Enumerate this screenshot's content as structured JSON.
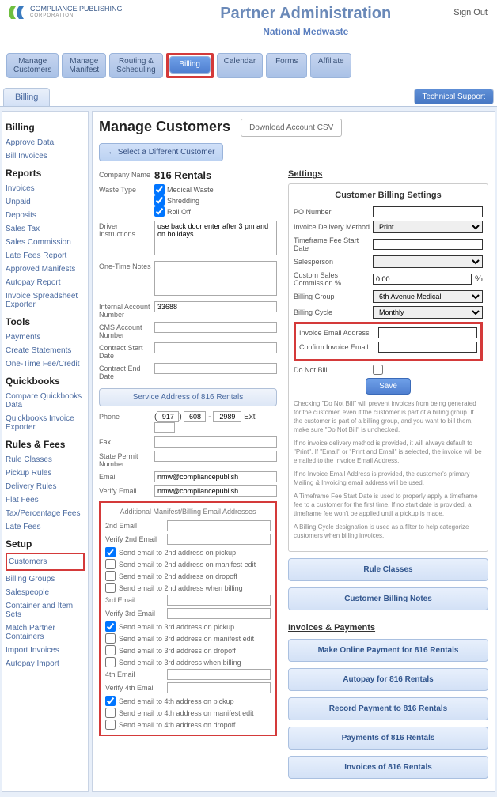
{
  "header": {
    "brand_top": "COMPLIANCE PUBLISHING",
    "brand_sub": "CORPORATION",
    "title": "Partner Administration",
    "subtitle": "National Medwaste",
    "signout": "Sign Out"
  },
  "nav": {
    "items": [
      {
        "line1": "Manage",
        "line2": "Customers"
      },
      {
        "line1": "Manage",
        "line2": "Manifest"
      },
      {
        "line1": "Routing &",
        "line2": "Scheduling"
      },
      {
        "line1": "Billing",
        "line2": ""
      },
      {
        "line1": "Calendar",
        "line2": ""
      },
      {
        "line1": "Forms",
        "line2": ""
      },
      {
        "line1": "Affiliate",
        "line2": ""
      }
    ],
    "active_index": 3
  },
  "tabs": {
    "main": "Billing",
    "support": "Technical Support"
  },
  "sidebar": {
    "sections": [
      {
        "heading": "Billing",
        "links": [
          "Approve Data",
          "Bill Invoices"
        ]
      },
      {
        "heading": "Reports",
        "links": [
          "Invoices",
          "Unpaid",
          "Deposits",
          "Sales Tax",
          "Sales Commission",
          "Late Fees Report",
          "Approved Manifests",
          "Autopay Report",
          "Invoice Spreadsheet Exporter"
        ]
      },
      {
        "heading": "Tools",
        "links": [
          "Payments",
          "Create Statements",
          "One-Time Fee/Credit"
        ]
      },
      {
        "heading": "Quickbooks",
        "links": [
          "Compare Quickbooks Data",
          "Quickbooks Invoice Exporter"
        ]
      },
      {
        "heading": "Rules & Fees",
        "links": [
          "Rule Classes",
          "Pickup Rules",
          "Delivery Rules",
          "Flat Fees",
          "Tax/Percentage Fees",
          "Late Fees"
        ]
      },
      {
        "heading": "Setup",
        "links": [
          "Customers",
          "Billing Groups",
          "Salespeople",
          "Container and Item Sets",
          "Match Partner Containers",
          "Import Invoices",
          "Autopay Import"
        ]
      }
    ],
    "highlighted_link": "Customers"
  },
  "main": {
    "title": "Manage Customers",
    "csv_btn": "Download Account CSV",
    "select_customer": "← Select a Different Customer",
    "company": {
      "label": "Company Name",
      "value": "816 Rentals",
      "waste_label": "Waste Type",
      "waste": [
        {
          "label": "Medical Waste",
          "checked": true
        },
        {
          "label": "Shredding",
          "checked": true
        },
        {
          "label": "Roll Off",
          "checked": true
        }
      ],
      "driver_label": "Driver Instructions",
      "driver_text": "use back door enter after 3 pm and on holidays",
      "onetime_label": "One-Time Notes",
      "onetime_text": "",
      "internal_label": "Internal Account Number",
      "internal_value": "33688",
      "cms_label": "CMS Account Number",
      "cms_value": "",
      "cstart_label": "Contract Start Date",
      "cstart_value": "",
      "cend_label": "Contract End Date",
      "cend_value": "",
      "svc_btn": "Service Address of 816 Rentals",
      "phone_label": "Phone",
      "phone_a": "917",
      "phone_b": "608",
      "phone_c": "2989",
      "ext_label": "Ext",
      "ext": "",
      "fax_label": "Fax",
      "fax": "",
      "permit_label": "State Permit Number",
      "permit": "",
      "email_label": "Email",
      "email": "nmw@compliancepublish",
      "vemail_label": "Verify Email",
      "vemail": "nmw@compliancepublish"
    },
    "addl": {
      "header": "Additional Manifest/Billing Email Addresses",
      "groups": [
        {
          "prefix": "2nd",
          "email": "",
          "verify": "",
          "checks": [
            {
              "label": "Send email to 2nd address on pickup",
              "checked": true
            },
            {
              "label": "Send email to 2nd address on manifest edit",
              "checked": false
            },
            {
              "label": "Send email to 2nd address on dropoff",
              "checked": false
            },
            {
              "label": "Send email to 2nd address when billing",
              "checked": false
            }
          ]
        },
        {
          "prefix": "3rd",
          "email": "",
          "verify": "",
          "checks": [
            {
              "label": "Send email to 3rd address on pickup",
              "checked": true
            },
            {
              "label": "Send email to 3rd address on manifest edit",
              "checked": false
            },
            {
              "label": "Send email to 3rd address on dropoff",
              "checked": false
            },
            {
              "label": "Send email to 3rd address when billing",
              "checked": false
            }
          ]
        },
        {
          "prefix": "4th",
          "email": "",
          "verify": "",
          "checks": [
            {
              "label": "Send email to 4th address on pickup",
              "checked": true
            },
            {
              "label": "Send email to 4th address on manifest edit",
              "checked": false
            },
            {
              "label": "Send email to 4th address on dropoff",
              "checked": false
            }
          ]
        }
      ],
      "email_suffix": " Email",
      "verify_prefix": "Verify "
    }
  },
  "settings": {
    "header": "Settings",
    "box_title": "Customer Billing Settings",
    "rows": {
      "po_label": "PO Number",
      "po_value": "",
      "delivery_label": "Invoice Delivery Method",
      "delivery_value": "Print",
      "tf_label": "Timeframe Fee Start Date",
      "tf_value": "",
      "sales_label": "Salesperson",
      "sales_value": "",
      "comm_label": "Custom Sales Commission %",
      "comm_value": "0.00",
      "comm_suffix": "%",
      "bg_label": "Billing Group",
      "bg_value": "6th Avenue Medical",
      "cycle_label": "Billing Cycle",
      "cycle_value": "Monthly",
      "iea_label": "Invoice Email Address",
      "iea_value": "",
      "cie_label": "Confirm Invoice Email",
      "cie_value": "",
      "dnb_label": "Do Not Bill",
      "dnb_checked": false,
      "save": "Save"
    },
    "help": [
      "Checking \"Do Not Bill\" will prevent invoices from being generated for the customer, even if the customer is part of a billing group. If the customer is part of a billing group, and you want to bill them, make sure \"Do Not Bill\" is unchecked.",
      "If no invoice delivery method is provided, it will always default to \"Print\". If \"Email\" or \"Print and Email\" is selected, the invoice will be emailed to the Invoice Email Address.",
      "If no Invoice Email Address is provided, the customer's primary Mailing & Invoicing email address will be used.",
      "A Timeframe Fee Start Date is used to properly apply a timeframe fee to a customer for the first time. If no start date is provided, a timeframe fee won't be applied until a pickup is made.",
      "A Billing Cycle designation is used as a filter to help categorize customers when billing invoices."
    ],
    "rule_classes_btn": "Rule Classes",
    "notes_btn": "Customer Billing Notes",
    "ip_header": "Invoices & Payments",
    "ip_buttons": [
      "Make Online Payment for 816 Rentals",
      "Autopay for 816 Rentals",
      "Record Payment to 816 Rentals",
      "Payments of 816 Rentals",
      "Invoices of 816 Rentals"
    ]
  }
}
